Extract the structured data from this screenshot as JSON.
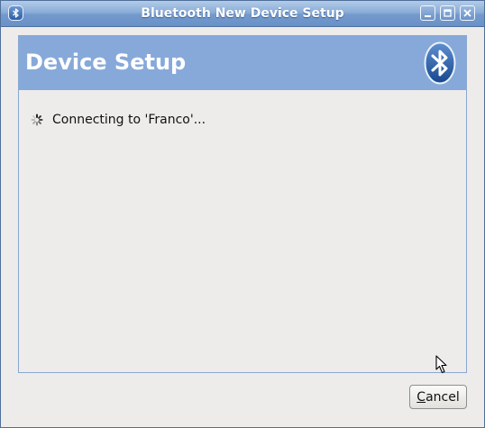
{
  "window": {
    "title": "Bluetooth New Device Setup",
    "app_icon": "bluetooth-icon",
    "controls": [
      "minimize-icon",
      "maximize-icon",
      "close-icon"
    ]
  },
  "banner": {
    "title": "Device Setup",
    "logo": "bluetooth-logo-icon",
    "color": "#86a9d9"
  },
  "status": {
    "icon": "spinner-icon",
    "text": "Connecting to 'Franco'..."
  },
  "actions": {
    "cancel_mnemonic": "C",
    "cancel_rest": "ancel"
  },
  "colors": {
    "titlebar": "#7399cc",
    "window_bg": "#edeceb",
    "desktop": "#6b2b4a"
  }
}
